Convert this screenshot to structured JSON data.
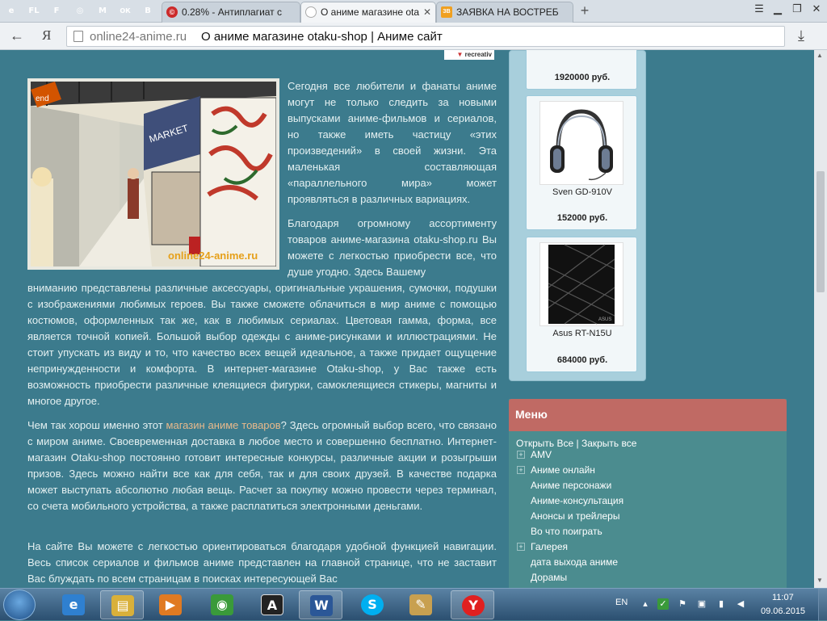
{
  "browser": {
    "pinned": [
      {
        "icon": "ie-icon",
        "glyph": "e",
        "color": "#2a74c9"
      },
      {
        "icon": "fl-icon",
        "glyph": "FL",
        "color": "#5aa82e"
      },
      {
        "icon": "f-icon",
        "glyph": "F",
        "color": "#5aa82e"
      },
      {
        "icon": "target-icon",
        "glyph": "◎",
        "color": "#2a74c9"
      },
      {
        "icon": "gmail-icon",
        "glyph": "M",
        "color": "#d64237"
      },
      {
        "icon": "ok-icon",
        "glyph": "ОК",
        "color": "#ee8208"
      },
      {
        "icon": "vk-icon",
        "glyph": "В",
        "color": "#4a76a8"
      }
    ],
    "tabs": [
      {
        "title": "0.28% - Антиплагиат с",
        "icon_color": "#cc2a2a",
        "active": false
      },
      {
        "title": "О аниме магазине ota",
        "icon_color": "#ffffff",
        "active": true
      },
      {
        "title": "ЗАЯВКА НА ВОСТРЕБ",
        "icon_color": "#f0a020",
        "active": false
      }
    ],
    "new_tab_glyph": "+",
    "window_controls": {
      "bookmarks": "☰",
      "minimize": "▁",
      "maximize": "❐",
      "close": "✕"
    }
  },
  "addressbar": {
    "back": "←",
    "yandex": "Я",
    "host": "online24-anime.ru",
    "title": "О аниме магазине otaku-shop | Аниме сайт",
    "star": "★",
    "download": "⤓"
  },
  "page": {
    "ad_badge": "recreativ",
    "image_watermark": "online24-anime.ru",
    "para1": "Сегодня все любители и фанаты аниме могут не только следить за новыми выпусками аниме-фильмов и сериалов, но также иметь частицу «этих произведений» в своей жизни. Эта маленькая составляющая «параллельного мира» может проявляться в различных вариациях.",
    "para2": "Благодаря огромному ассортименту товаров аниме-магазина otaku-shop.ru Вы можете с легкостью приобрести все, что душе угодно. Здесь Вашему",
    "para2_cont": "вниманию представлены различные аксессуары, оригинальные украшения, сумочки, подушки с изображениями любимых героев. Вы также сможете облачиться в мир аниме с помощью костюмов, оформленных так же, как в любимых сериалах. Цветовая гамма, форма, все является точной копией. Большой выбор одежды с аниме-рисунками и иллюстрациями. Не стоит упускать из виду и то, что качество всех вещей идеальное, а также придает ощущение непринужденности и комфорта. В интернет-магазине Otaku-shop, у Вас также есть возможность приобрести различные клеящиеся фигурки, самоклеящиеся стикеры, магниты и многое другое.",
    "para3_before": "Чем так хорош именно этот ",
    "para3_link": "магазин аниме товаров",
    "para3_after": "? Здесь огромный выбор всего, что связано с миром аниме. Своевременная доставка в любое место и совершенно бесплатно. Интернет-магазин Otaku-shop постоянно готовит интересные конкурсы, различные акции и розыгрыши призов. Здесь можно найти все как для себя, так и для своих друзей. В качестве подарка может выступать абсолютно любая вещь. Расчет за покупку можно провести через терминал, со счета мобильного устройства, а также расплатиться электронными деньгами.",
    "para4": "На сайте Вы можете с легкостью ориентироваться благодаря удобной функцией навигации. Весь список сериалов и фильмов аниме представлен на главной странице, что не заставит Вас блуждать по всем страницам в поисках интересующей Вас"
  },
  "products": [
    {
      "name": "",
      "price": "1920000 руб."
    },
    {
      "name": "Sven GD-910V",
      "price": "152000 руб."
    },
    {
      "name": "Asus RT-N15U",
      "price": "684000 руб."
    }
  ],
  "menu": {
    "title": "Меню",
    "open_all": "Открыть Все",
    "separator": "|",
    "close_all": "Закрыть все",
    "items": [
      {
        "label": "AMV",
        "expandable": true
      },
      {
        "label": "Аниме онлайн",
        "expandable": true
      },
      {
        "label": "Аниме персонажи",
        "expandable": false
      },
      {
        "label": "Аниме-консультация",
        "expandable": false
      },
      {
        "label": "Анонсы и трейлеры",
        "expandable": false
      },
      {
        "label": "Во что поиграть",
        "expandable": false
      },
      {
        "label": "Галерея",
        "expandable": true
      },
      {
        "label": "дата выхода аниме",
        "expandable": false
      },
      {
        "label": "Дорамы",
        "expandable": false
      }
    ]
  },
  "taskbar": {
    "apps": [
      {
        "name": "ie",
        "glyph": "e",
        "color": "#2f80d0",
        "open": false
      },
      {
        "name": "explorer",
        "glyph": "▤",
        "color": "#d9b03a",
        "open": true
      },
      {
        "name": "media-player",
        "glyph": "▶",
        "color": "#e07a22",
        "open": false
      },
      {
        "name": "chrome",
        "glyph": "◉",
        "color": "#3a9a3a",
        "open": false
      },
      {
        "name": "font-viewer",
        "glyph": "A",
        "color": "#ffffff",
        "open": false
      },
      {
        "name": "word",
        "glyph": "W",
        "color": "#2b5797",
        "open": true
      },
      {
        "name": "skype",
        "glyph": "S",
        "color": "#00aff0",
        "open": false
      },
      {
        "name": "paint",
        "glyph": "✎",
        "color": "#c8a050",
        "open": false
      },
      {
        "name": "yandex-browser",
        "glyph": "Y",
        "color": "#e02020",
        "open": true
      }
    ],
    "language": "EN",
    "time": "11:07",
    "date": "09.06.2015"
  }
}
